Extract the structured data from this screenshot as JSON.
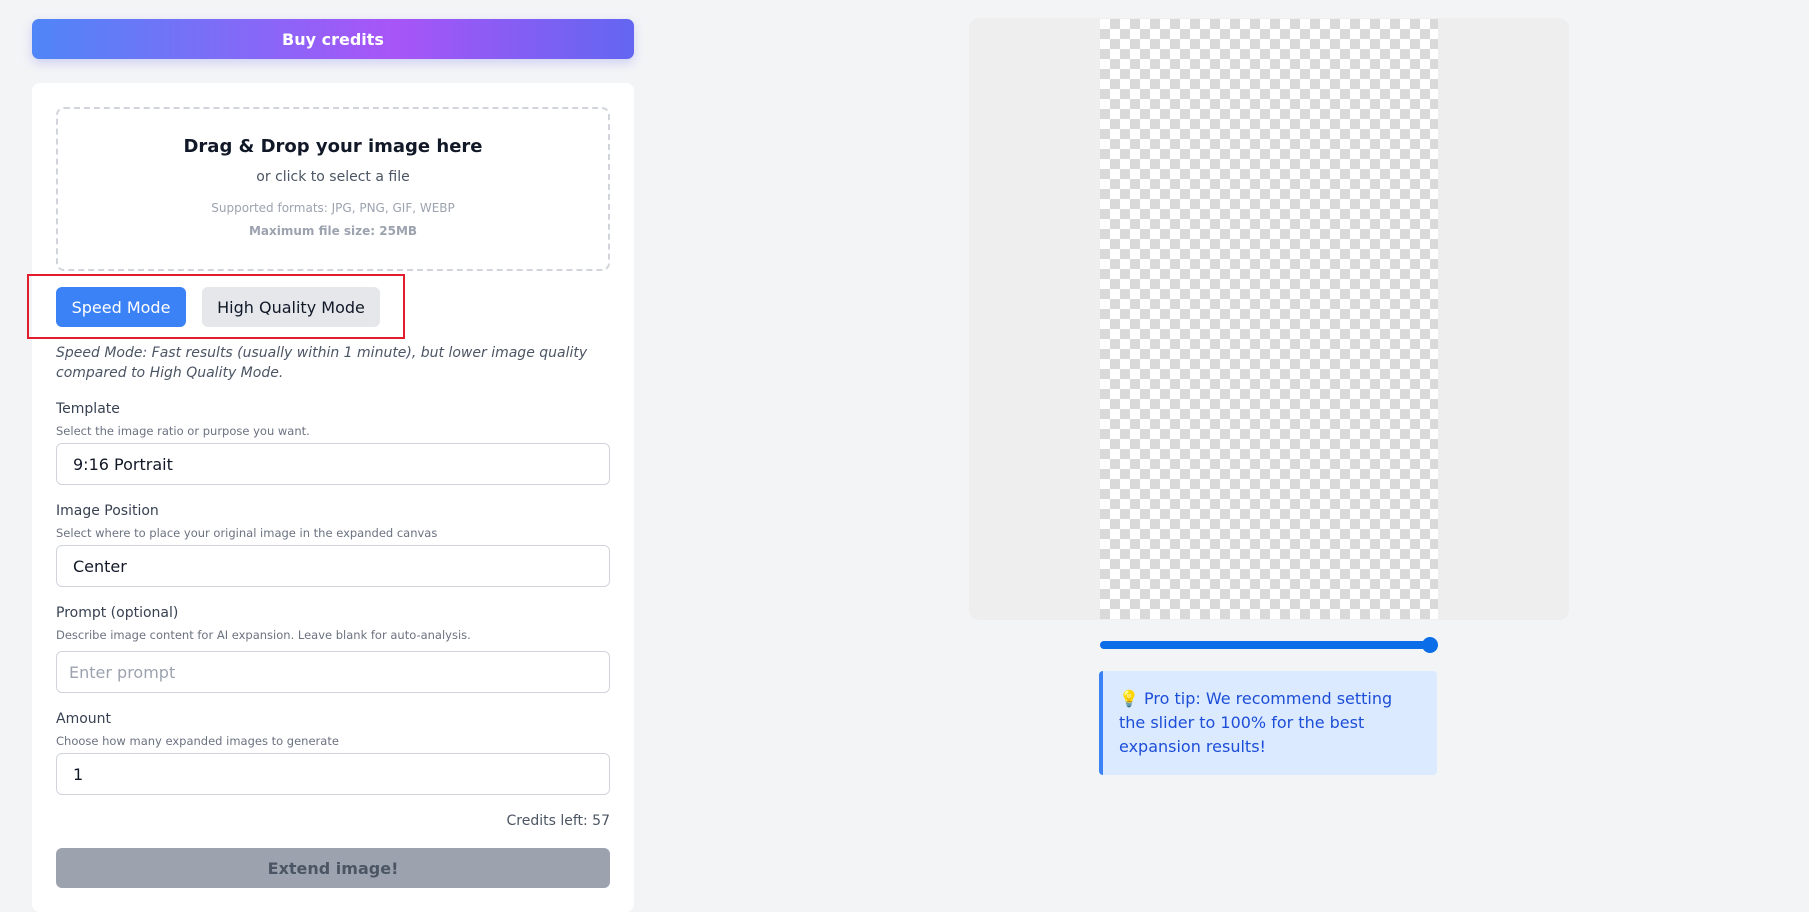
{
  "header": {
    "buy_credits_label": "Buy credits"
  },
  "dropzone": {
    "title": "Drag & Drop your image here",
    "subtitle": "or click to select a file",
    "formats": "Supported formats: JPG, PNG, GIF, WEBP",
    "max_size": "Maximum file size: 25MB"
  },
  "modes": {
    "speed_label": "Speed Mode",
    "hq_label": "High Quality Mode",
    "active": "Speed Mode",
    "description": "Speed Mode: Fast results (usually within 1 minute), but lower image quality compared to High Quality Mode."
  },
  "template": {
    "label": "Template",
    "help": "Select the image ratio or purpose you want.",
    "value": "9:16 Portrait"
  },
  "position": {
    "label": "Image Position",
    "help": "Select where to place your original image in the expanded canvas",
    "value": "Center"
  },
  "prompt": {
    "label": "Prompt (optional)",
    "help": "Describe image content for AI expansion. Leave blank for auto-analysis.",
    "placeholder": "Enter prompt",
    "value": ""
  },
  "amount": {
    "label": "Amount",
    "help": "Choose how many expanded images to generate",
    "value": "1"
  },
  "credits_left": "Credits left: 57",
  "extend_label": "Extend image!",
  "slider": {
    "value_percent": 100,
    "color": "#0b6ee8"
  },
  "tip": {
    "icon": "lightbulb-icon",
    "text": "Pro tip: We recommend setting the slider to 100% for the best expansion results!"
  },
  "colors": {
    "primary": "#3b82f6",
    "gradient_start": "#4f86f7",
    "gradient_end": "#a855f7",
    "highlight": "#e11d2e"
  }
}
